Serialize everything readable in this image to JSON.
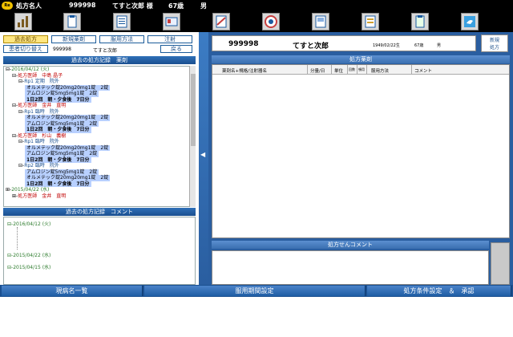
{
  "title": {
    "logo_text": "Re",
    "label": "処方名人",
    "patient_id": "999998",
    "patient_name": "てすと次郎 様",
    "age": "67歳",
    "sex": "男"
  },
  "toolbar": {
    "icons": [
      "chart-icon",
      "clipboard-icon",
      "document-icon",
      "card-icon",
      "diagonal-doc-icon",
      "target-icon",
      "panel-doc-icon",
      "list-doc-icon",
      "clipboard-icon",
      "bird-icon"
    ]
  },
  "left": {
    "tabs": {
      "past_rx": "過去処方",
      "new_drug": "新規薬剤",
      "usage": "服用方法",
      "injection": "注射",
      "switch_patient": "患者切り替え",
      "back": "戻る"
    },
    "patient": {
      "id": "999998",
      "name": "てすと次郎"
    },
    "history_header": "過去の処方記録　薬剤",
    "comment_header": "過去の処方記録　コメント",
    "tree": [
      {
        "cls": "dt",
        "indent": 0,
        "prefix": "⊟-",
        "text": "2016/04/12 (火)"
      },
      {
        "cls": "dr",
        "indent": 1,
        "prefix": "⊟-",
        "text": "処方医師　中島 晶子"
      },
      {
        "cls": "rp",
        "indent": 2,
        "prefix": "⊟-",
        "text": "Rp1 定期　院外"
      },
      {
        "cls": "drug",
        "indent": 3,
        "prefix": "",
        "text": "オルメテック錠20mg20mg1錠　2錠"
      },
      {
        "cls": "drug",
        "indent": 3,
        "prefix": "",
        "text": "アムロジン錠5mg5mg1錠　2錠"
      },
      {
        "cls": "dose",
        "indent": 3,
        "prefix": "",
        "text": "1日2回　朝・夕食後　7日分"
      },
      {
        "cls": "dr",
        "indent": 1,
        "prefix": "⊟-",
        "text": "処方医師　金井　直明"
      },
      {
        "cls": "rp",
        "indent": 2,
        "prefix": "⊟-",
        "text": "Rp1 臨時　院外"
      },
      {
        "cls": "drug",
        "indent": 3,
        "prefix": "",
        "text": "オルメテック錠20mg20mg1錠　2錠"
      },
      {
        "cls": "drug",
        "indent": 3,
        "prefix": "",
        "text": "アムロジン錠5mg5mg1錠　2錠"
      },
      {
        "cls": "dose",
        "indent": 3,
        "prefix": "",
        "text": "1日2回　朝・夕食後　7日分"
      },
      {
        "cls": "dr",
        "indent": 1,
        "prefix": "⊟-",
        "text": "処方医師　杉山　義樹"
      },
      {
        "cls": "rp",
        "indent": 2,
        "prefix": "⊟-",
        "text": "Rp1 臨時　院外"
      },
      {
        "cls": "drug",
        "indent": 3,
        "prefix": "",
        "text": "オルメテック錠20mg20mg1錠　2錠"
      },
      {
        "cls": "drug",
        "indent": 3,
        "prefix": "",
        "text": "アムロジン錠5mg5mg1錠　2錠"
      },
      {
        "cls": "dose",
        "indent": 3,
        "prefix": "",
        "text": "1日2回　朝・夕食後　7日分"
      },
      {
        "cls": "rp",
        "indent": 2,
        "prefix": "⊟-",
        "text": "Rp2 臨時　院外"
      },
      {
        "cls": "drug",
        "indent": 3,
        "prefix": "",
        "text": "アムロジン錠5mg5mg1錠　2錠"
      },
      {
        "cls": "drug",
        "indent": 3,
        "prefix": "",
        "text": "オルメテック錠20mg20mg1錠　2錠"
      },
      {
        "cls": "dose",
        "indent": 3,
        "prefix": "",
        "text": "1日2回　朝・夕食後　7日分"
      },
      {
        "cls": "dt",
        "indent": 0,
        "prefix": "⊞-",
        "text": "2015/04/22 (水)"
      },
      {
        "cls": "dr",
        "indent": 1,
        "prefix": "⊞-",
        "text": "処方医師　金井　直明"
      }
    ],
    "comment_dates": [
      "2016/04/12 (火)",
      "2015/04/22 (水)",
      "2015/04/15 (水)"
    ]
  },
  "right": {
    "patient_id": "999998",
    "patient_name": "てすと次郎",
    "dob": "1949/02/22生",
    "age": "67歳",
    "sex": "男",
    "new_rx_button": "新規\n処方",
    "rx_drugs_header": "処方薬剤",
    "columns": [
      "薬剤名+規格/注射器名",
      "分量/日",
      "単位",
      "回数",
      "頓用",
      "服用方法",
      "コメント"
    ],
    "rx_comment_header": "処方せんコメント"
  },
  "bottom": {
    "disease_list": "現病名一覧",
    "period_setting": "服用期間設定",
    "condition_approval": "処方条件設定　＆　承認"
  }
}
